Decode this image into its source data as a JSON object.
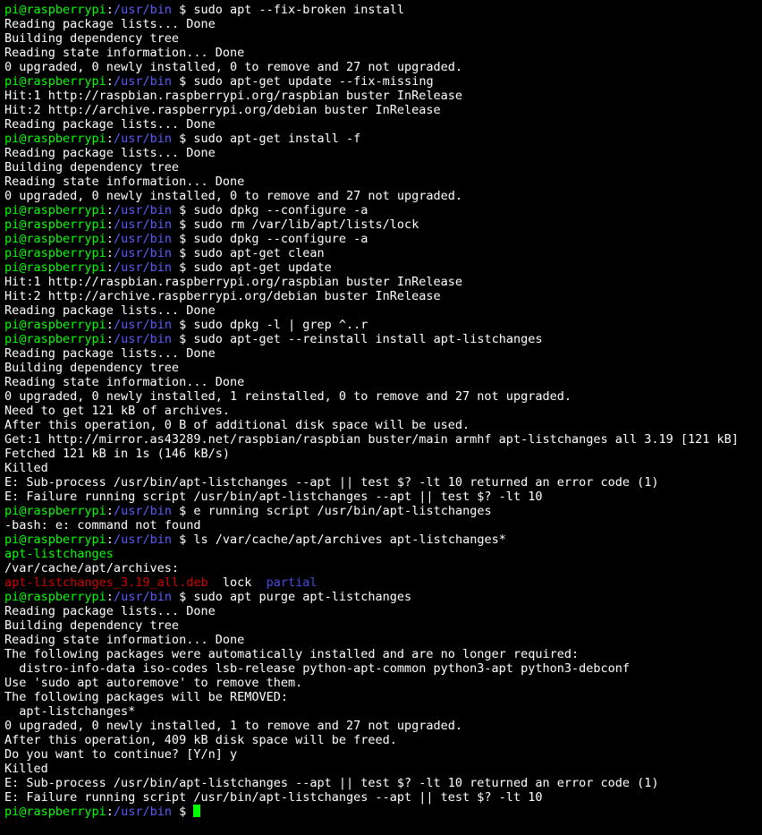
{
  "prompt": {
    "user": "pi@raspberrypi",
    "sep": ":",
    "path": "/usr/bin",
    "mark": " $ "
  },
  "lines": [
    {
      "prompt": true,
      "cmd": "sudo apt --fix-broken install"
    },
    {
      "text": "Reading package lists... Done"
    },
    {
      "text": "Building dependency tree"
    },
    {
      "text": "Reading state information... Done"
    },
    {
      "text": "0 upgraded, 0 newly installed, 0 to remove and 27 not upgraded."
    },
    {
      "prompt": true,
      "cmd": "sudo apt-get update --fix-missing"
    },
    {
      "text": "Hit:1 http://raspbian.raspberrypi.org/raspbian buster InRelease"
    },
    {
      "text": "Hit:2 http://archive.raspberrypi.org/debian buster InRelease"
    },
    {
      "text": "Reading package lists... Done"
    },
    {
      "prompt": true,
      "cmd": "sudo apt-get install -f"
    },
    {
      "text": "Reading package lists... Done"
    },
    {
      "text": "Building dependency tree"
    },
    {
      "text": "Reading state information... Done"
    },
    {
      "text": "0 upgraded, 0 newly installed, 0 to remove and 27 not upgraded."
    },
    {
      "prompt": true,
      "cmd": "sudo dpkg --configure -a"
    },
    {
      "prompt": true,
      "cmd": "sudo rm /var/lib/apt/lists/lock"
    },
    {
      "prompt": true,
      "cmd": "sudo dpkg --configure -a"
    },
    {
      "prompt": true,
      "cmd": "sudo apt-get clean"
    },
    {
      "prompt": true,
      "cmd": "sudo apt-get update"
    },
    {
      "text": "Hit:1 http://raspbian.raspberrypi.org/raspbian buster InRelease"
    },
    {
      "text": "Hit:2 http://archive.raspberrypi.org/debian buster InRelease"
    },
    {
      "text": "Reading package lists... Done"
    },
    {
      "prompt": true,
      "cmd": "sudo dpkg -l | grep ^..r"
    },
    {
      "prompt": true,
      "cmd": "sudo apt-get --reinstall install apt-listchanges"
    },
    {
      "text": "Reading package lists... Done"
    },
    {
      "text": "Building dependency tree"
    },
    {
      "text": "Reading state information... Done"
    },
    {
      "text": "0 upgraded, 0 newly installed, 1 reinstalled, 0 to remove and 27 not upgraded."
    },
    {
      "text": "Need to get 121 kB of archives."
    },
    {
      "text": "After this operation, 0 B of additional disk space will be used."
    },
    {
      "text": "Get:1 http://mirror.as43289.net/raspbian/raspbian buster/main armhf apt-listchanges all 3.19 [121 kB]"
    },
    {
      "text": "Fetched 121 kB in 1s (146 kB/s)"
    },
    {
      "text": "Killed"
    },
    {
      "text": "E: Sub-process /usr/bin/apt-listchanges --apt || test $? -lt 10 returned an error code (1)"
    },
    {
      "text": "E: Failure running script /usr/bin/apt-listchanges --apt || test $? -lt 10"
    },
    {
      "prompt": true,
      "cmd": "e running script /usr/bin/apt-listchanges"
    },
    {
      "text": "-bash: e: command not found"
    },
    {
      "prompt": true,
      "cmd": "ls /var/cache/apt/archives apt-listchanges*"
    },
    {
      "text": "apt-listchanges",
      "cls": "g"
    },
    {
      "text": ""
    },
    {
      "text": "/var/cache/apt/archives:"
    },
    {
      "dirline": true
    },
    {
      "prompt": true,
      "cmd": "sudo apt purge apt-listchanges"
    },
    {
      "text": "Reading package lists... Done"
    },
    {
      "text": "Building dependency tree"
    },
    {
      "text": "Reading state information... Done"
    },
    {
      "text": "The following packages were automatically installed and are no longer required:"
    },
    {
      "text": "  distro-info-data iso-codes lsb-release python-apt-common python3-apt python3-debconf"
    },
    {
      "text": "Use 'sudo apt autoremove' to remove them."
    },
    {
      "text": "The following packages will be REMOVED:"
    },
    {
      "text": "  apt-listchanges*"
    },
    {
      "text": "0 upgraded, 0 newly installed, 1 to remove and 27 not upgraded."
    },
    {
      "text": "After this operation, 409 kB disk space will be freed."
    },
    {
      "text": "Do you want to continue? [Y/n] y"
    },
    {
      "text": "Killed"
    },
    {
      "text": "E: Sub-process /usr/bin/apt-listchanges --apt || test $? -lt 10 returned an error code (1)"
    },
    {
      "text": "E: Failure running script /usr/bin/apt-listchanges --apt || test $? -lt 10"
    },
    {
      "prompt": true,
      "cmd": "",
      "cursor": true
    }
  ],
  "dir": {
    "deb": "apt-listchanges_3.19_all.deb",
    "lock": "lock",
    "partial": "partial"
  }
}
